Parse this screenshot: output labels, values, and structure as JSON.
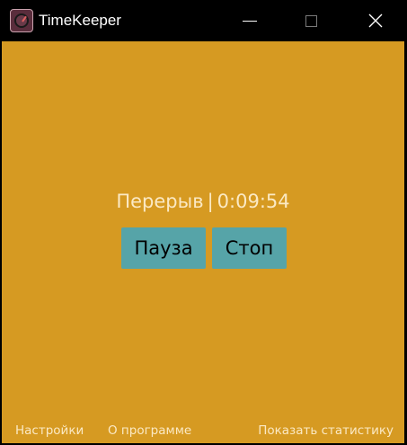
{
  "window": {
    "title": "TimeKeeper",
    "icon": "stopwatch-icon",
    "controls": [
      "minimize-icon",
      "maximize-icon",
      "close-icon"
    ]
  },
  "timer": {
    "mode": "Перерыв",
    "separator": "|",
    "time": "0:09:54"
  },
  "buttons": {
    "pause": "Пауза",
    "stop": "Стоп"
  },
  "footer": {
    "settings": "Настройки",
    "about": "О программе",
    "stats": "Показать статистику"
  },
  "colors": {
    "background": "#d69a22",
    "button": "#56a4a8",
    "text_light": "#fbe9c4",
    "titlebar": "#000000"
  }
}
